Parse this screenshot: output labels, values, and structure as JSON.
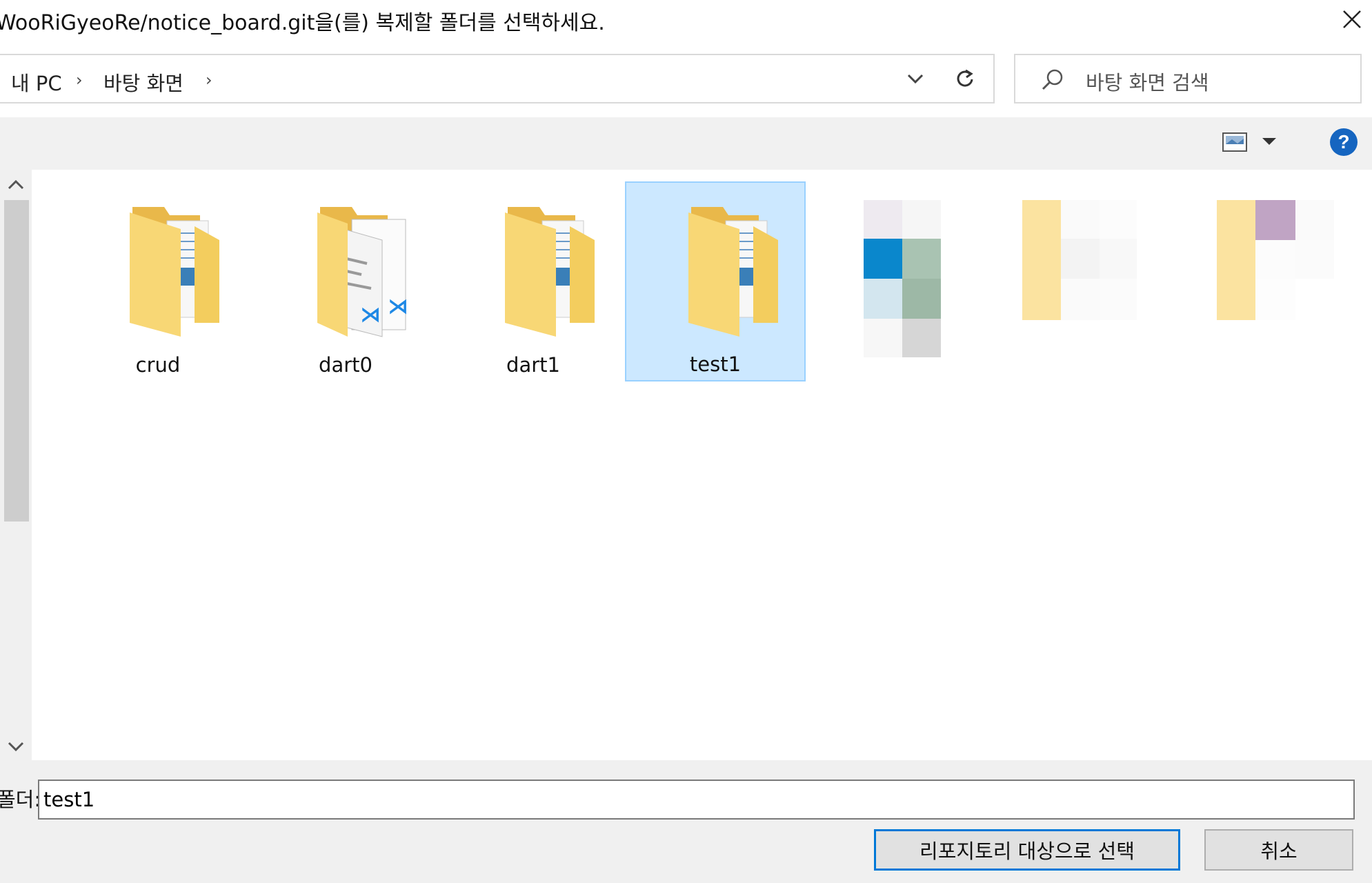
{
  "dialog": {
    "title": "WooRiGyeoRe/notice_board.git을(를) 복제할 폴더를 선택하세요."
  },
  "address_bar": {
    "breadcrumbs": [
      "내 PC",
      "바탕 화면"
    ]
  },
  "search": {
    "placeholder": "바탕 화면 검색"
  },
  "colors": {
    "accent": "#0078d7",
    "selection_fill": "#cce8ff",
    "selection_border": "#99d1ff",
    "folder_yellow": "#f8d775",
    "help_blue": "#1565c0"
  },
  "items": [
    {
      "name": "crud",
      "type": "folder",
      "selected": false
    },
    {
      "name": "dart0",
      "type": "folder-vscode",
      "selected": false
    },
    {
      "name": "dart1",
      "type": "folder",
      "selected": false
    },
    {
      "name": "test1",
      "type": "folder",
      "selected": true
    },
    {
      "name": "",
      "type": "blurred-icon",
      "selected": false
    },
    {
      "name": "",
      "type": "blurred-icon",
      "selected": false
    },
    {
      "name": "",
      "type": "blurred-icon",
      "selected": false
    }
  ],
  "footer": {
    "folder_label": "폴더:",
    "folder_value": "test1",
    "select_button": "리포지토리 대상으로 선택",
    "cancel_button": "취소"
  }
}
